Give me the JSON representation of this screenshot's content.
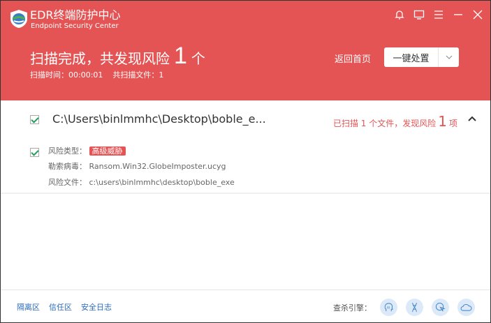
{
  "app": {
    "title": "EDR终端防护中心",
    "subtitle": "Endpoint Security Center"
  },
  "header": {
    "headline": "扫描完成，共发现风险",
    "risk_count": "1",
    "unit": "个",
    "scan_time": "扫描时间：00:00:01",
    "scanned_files": "共扫描文件：1",
    "home": "返回首页",
    "action": "一键处置"
  },
  "result": {
    "path": "C:\\Users\\binlmmhc\\Desktop\\boble_e...",
    "summary_prefix": "已扫描 1 个文件，发现风险",
    "summary_count": "1",
    "summary_suffix": "项",
    "risk_type_label": "风险类型：",
    "risk_type": "高级威胁",
    "virus_label": "勒索病毒：",
    "virus": "Ransom.Win32.GlobeImposter.ucyg",
    "file_label": "风险文件：",
    "file": "c:\\users\\binlmmhc\\desktop\\boble_exe"
  },
  "footer": {
    "links": [
      "隔离区",
      "信任区",
      "安全日志"
    ],
    "engines_label": "查杀引擎："
  },
  "colors": {
    "accent": "#e55454",
    "link": "#2a6bbf"
  }
}
